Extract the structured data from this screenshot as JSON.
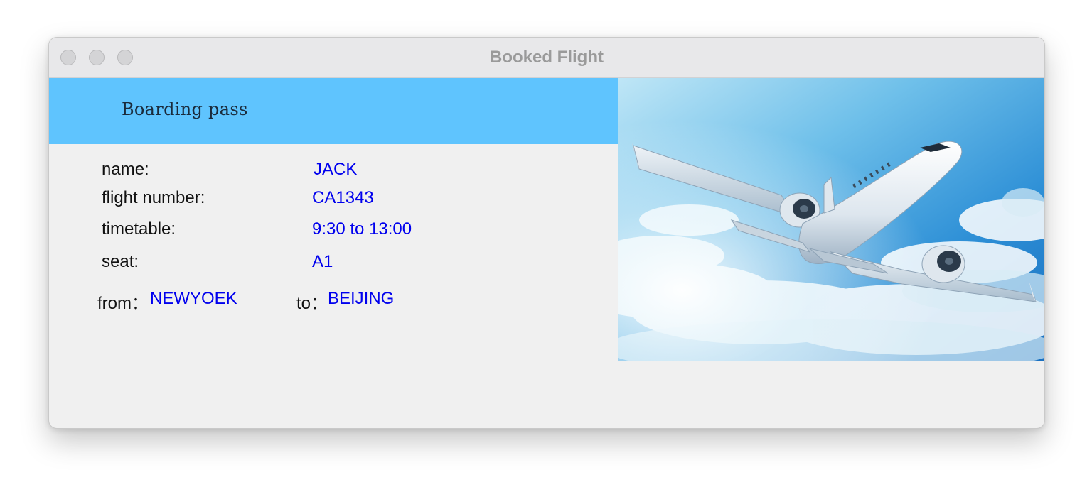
{
  "window": {
    "title": "Booked Flight"
  },
  "banner": {
    "title": "Boarding pass"
  },
  "fields": {
    "name_label": "name:",
    "name_value": "JACK",
    "flight_label": "flight number:",
    "flight_value": "CA1343",
    "timetable_label": "timetable:",
    "timetable_value": "9:30 to 13:00",
    "seat_label": "seat:",
    "seat_value": "A1",
    "from_label": "from：",
    "from_value": "NEWYOEK",
    "to_label": "to：",
    "to_value": "BEIJING"
  },
  "image": {
    "subject": "airplane-in-sky"
  },
  "colors": {
    "banner": "#5fc4fe",
    "value_text": "#0000ee",
    "label_text": "#111111"
  }
}
